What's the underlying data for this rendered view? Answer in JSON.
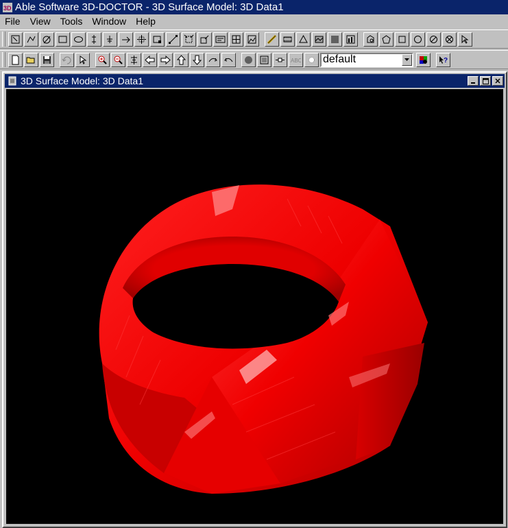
{
  "app": {
    "title": "Able Software 3D-DOCTOR - 3D Surface Model: 3D Data1",
    "icon": "3d-doctor-app-icon"
  },
  "menu": [
    {
      "label": "File"
    },
    {
      "label": "View"
    },
    {
      "label": "Tools"
    },
    {
      "label": "Window"
    },
    {
      "label": "Help"
    }
  ],
  "toolbar1": {
    "icons": [
      "select-rect-icon",
      "polyline-icon",
      "freehand-icon",
      "rectangle-icon",
      "ellipse-icon",
      "split-icon",
      "merge-icon",
      "point-icon",
      "crosshair-icon",
      "region-icon",
      "diagonal-icon",
      "resize-icon",
      "edit-icon",
      "label-icon",
      "grid-icon",
      "image-icon",
      "ruler-icon",
      "scan-icon",
      "triangle-icon",
      "surface-icon",
      "volume-icon",
      "histogram-icon",
      "shape1-icon",
      "pentagon-icon",
      "square-icon",
      "circle-icon",
      "compass-icon",
      "x-shape-icon",
      "pointer-arrow-icon"
    ]
  },
  "toolbar2": {
    "icons": [
      "new-file-icon",
      "open-folder-icon",
      "save-disk-icon",
      "undo-icon",
      "pointer-icon",
      "zoom-in-icon",
      "zoom-out-icon",
      "fit-icon",
      "arrow-left-icon",
      "arrow-right-icon",
      "arrow-up-icon",
      "arrow-down-icon",
      "rotate-left-icon",
      "rotate-right-icon",
      "render-sphere-icon",
      "wireframe-icon",
      "slice-icon",
      "text-abc-icon",
      "light-icon"
    ],
    "dropdown_value": "default",
    "after_icons": [
      "palette-icon",
      "context-help-icon"
    ]
  },
  "document": {
    "title": "3D Surface Model: 3D Data1",
    "icon": "document-icon"
  },
  "colors": {
    "titlebar": "#0a246a",
    "chrome": "#c0c0c0",
    "model": "#ee0000",
    "viewport": "#000000"
  }
}
